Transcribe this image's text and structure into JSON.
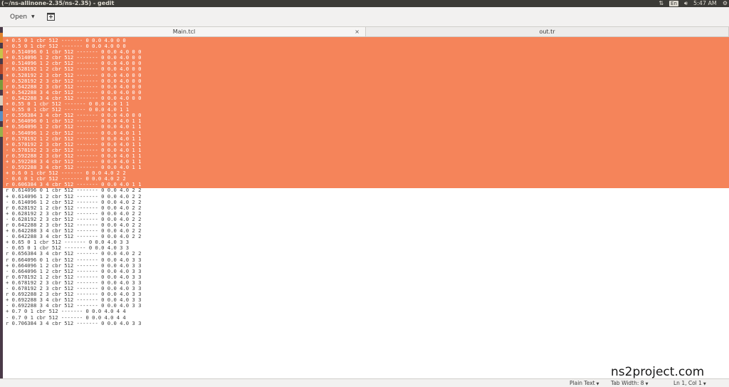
{
  "window": {
    "title": "(~/ns-allinone-2.35/ns-2.35) - gedit",
    "time": "5:47 AM",
    "keyboard_layout": "En"
  },
  "toolbar": {
    "open_label": "Open"
  },
  "tabs": [
    {
      "label": "Main.tcl",
      "active": true
    },
    {
      "label": "out.tr",
      "active": false
    }
  ],
  "editor": {
    "selection_color": "#f5845a",
    "lines": [
      "+ 0.5 0 1 cbr 512 ------- 0 0.0 4.0 0 0",
      "- 0.5 0 1 cbr 512 ------- 0 0.0 4.0 0 0",
      "r 0.514096 0 1 cbr 512 ------- 0 0.0 4.0 0 0",
      "+ 0.514096 1 2 cbr 512 ------- 0 0.0 4.0 0 0",
      "- 0.514096 1 2 cbr 512 ------- 0 0.0 4.0 0 0",
      "r 0.528192 1 2 cbr 512 ------- 0 0.0 4.0 0 0",
      "+ 0.528192 2 3 cbr 512 ------- 0 0.0 4.0 0 0",
      "- 0.528192 2 3 cbr 512 ------- 0 0.0 4.0 0 0",
      "r 0.542288 2 3 cbr 512 ------- 0 0.0 4.0 0 0",
      "+ 0.542288 3 4 cbr 512 ------- 0 0.0 4.0 0 0",
      "- 0.542288 3 4 cbr 512 ------- 0 0.0 4.0 0 0",
      "+ 0.55 0 1 cbr 512 ------- 0 0.0 4.0 1 1",
      "- 0.55 0 1 cbr 512 ------- 0 0.0 4.0 1 1",
      "r 0.556384 3 4 cbr 512 ------- 0 0.0 4.0 0 0",
      "r 0.564096 0 1 cbr 512 ------- 0 0.0 4.0 1 1",
      "+ 0.564096 1 2 cbr 512 ------- 0 0.0 4.0 1 1",
      "- 0.564096 1 2 cbr 512 ------- 0 0.0 4.0 1 1",
      "r 0.578192 1 2 cbr 512 ------- 0 0.0 4.0 1 1",
      "+ 0.578192 2 3 cbr 512 ------- 0 0.0 4.0 1 1",
      "- 0.578192 2 3 cbr 512 ------- 0 0.0 4.0 1 1",
      "r 0.592288 2 3 cbr 512 ------- 0 0.0 4.0 1 1",
      "+ 0.592288 3 4 cbr 512 ------- 0 0.0 4.0 1 1",
      "- 0.592288 3 4 cbr 512 ------- 0 0.0 4.0 1 1",
      "+ 0.6 0 1 cbr 512 ------- 0 0.0 4.0 2 2",
      "- 0.6 0 1 cbr 512 ------- 0 0.0 4.0 2 2",
      "r 0.606384 3 4 cbr 512 ------- 0 0.0 4.0 1 1",
      "r 0.614096 0 1 cbr 512 ------- 0 0.0 4.0 2 2",
      "+ 0.614096 1 2 cbr 512 ------- 0 0.0 4.0 2 2",
      "- 0.614096 1 2 cbr 512 ------- 0 0.0 4.0 2 2",
      "r 0.628192 1 2 cbr 512 ------- 0 0.0 4.0 2 2",
      "+ 0.628192 2 3 cbr 512 ------- 0 0.0 4.0 2 2",
      "- 0.628192 2 3 cbr 512 ------- 0 0.0 4.0 2 2",
      "r 0.642288 2 3 cbr 512 ------- 0 0.0 4.0 2 2",
      "+ 0.642288 3 4 cbr 512 ------- 0 0.0 4.0 2 2",
      "- 0.642288 3 4 cbr 512 ------- 0 0.0 4.0 2 2",
      "+ 0.65 0 1 cbr 512 ------- 0 0.0 4.0 3 3",
      "- 0.65 0 1 cbr 512 ------- 0 0.0 4.0 3 3",
      "r 0.656384 3 4 cbr 512 ------- 0 0.0 4.0 2 2",
      "r 0.664096 0 1 cbr 512 ------- 0 0.0 4.0 3 3",
      "+ 0.664096 1 2 cbr 512 ------- 0 0.0 4.0 3 3",
      "- 0.664096 1 2 cbr 512 ------- 0 0.0 4.0 3 3",
      "r 0.678192 1 2 cbr 512 ------- 0 0.0 4.0 3 3",
      "+ 0.678192 2 3 cbr 512 ------- 0 0.0 4.0 3 3",
      "- 0.678192 2 3 cbr 512 ------- 0 0.0 4.0 3 3",
      "r 0.692288 2 3 cbr 512 ------- 0 0.0 4.0 3 3",
      "+ 0.692288 3 4 cbr 512 ------- 0 0.0 4.0 3 3",
      "- 0.692288 3 4 cbr 512 ------- 0 0.0 4.0 3 3",
      "+ 0.7 0 1 cbr 512 ------- 0 0.0 4.0 4 4",
      "- 0.7 0 1 cbr 512 ------- 0 0.0 4.0 4 4",
      "r 0.706384 3 4 cbr 512 ------- 0 0.0 4.0 3 3"
    ],
    "selected_line_count": 26
  },
  "status_bar": {
    "language": "Plain Text",
    "tab_width": "Tab Width: 8",
    "cursor_position": "Ln 1, Col 1"
  },
  "watermark": "ns2project.com"
}
